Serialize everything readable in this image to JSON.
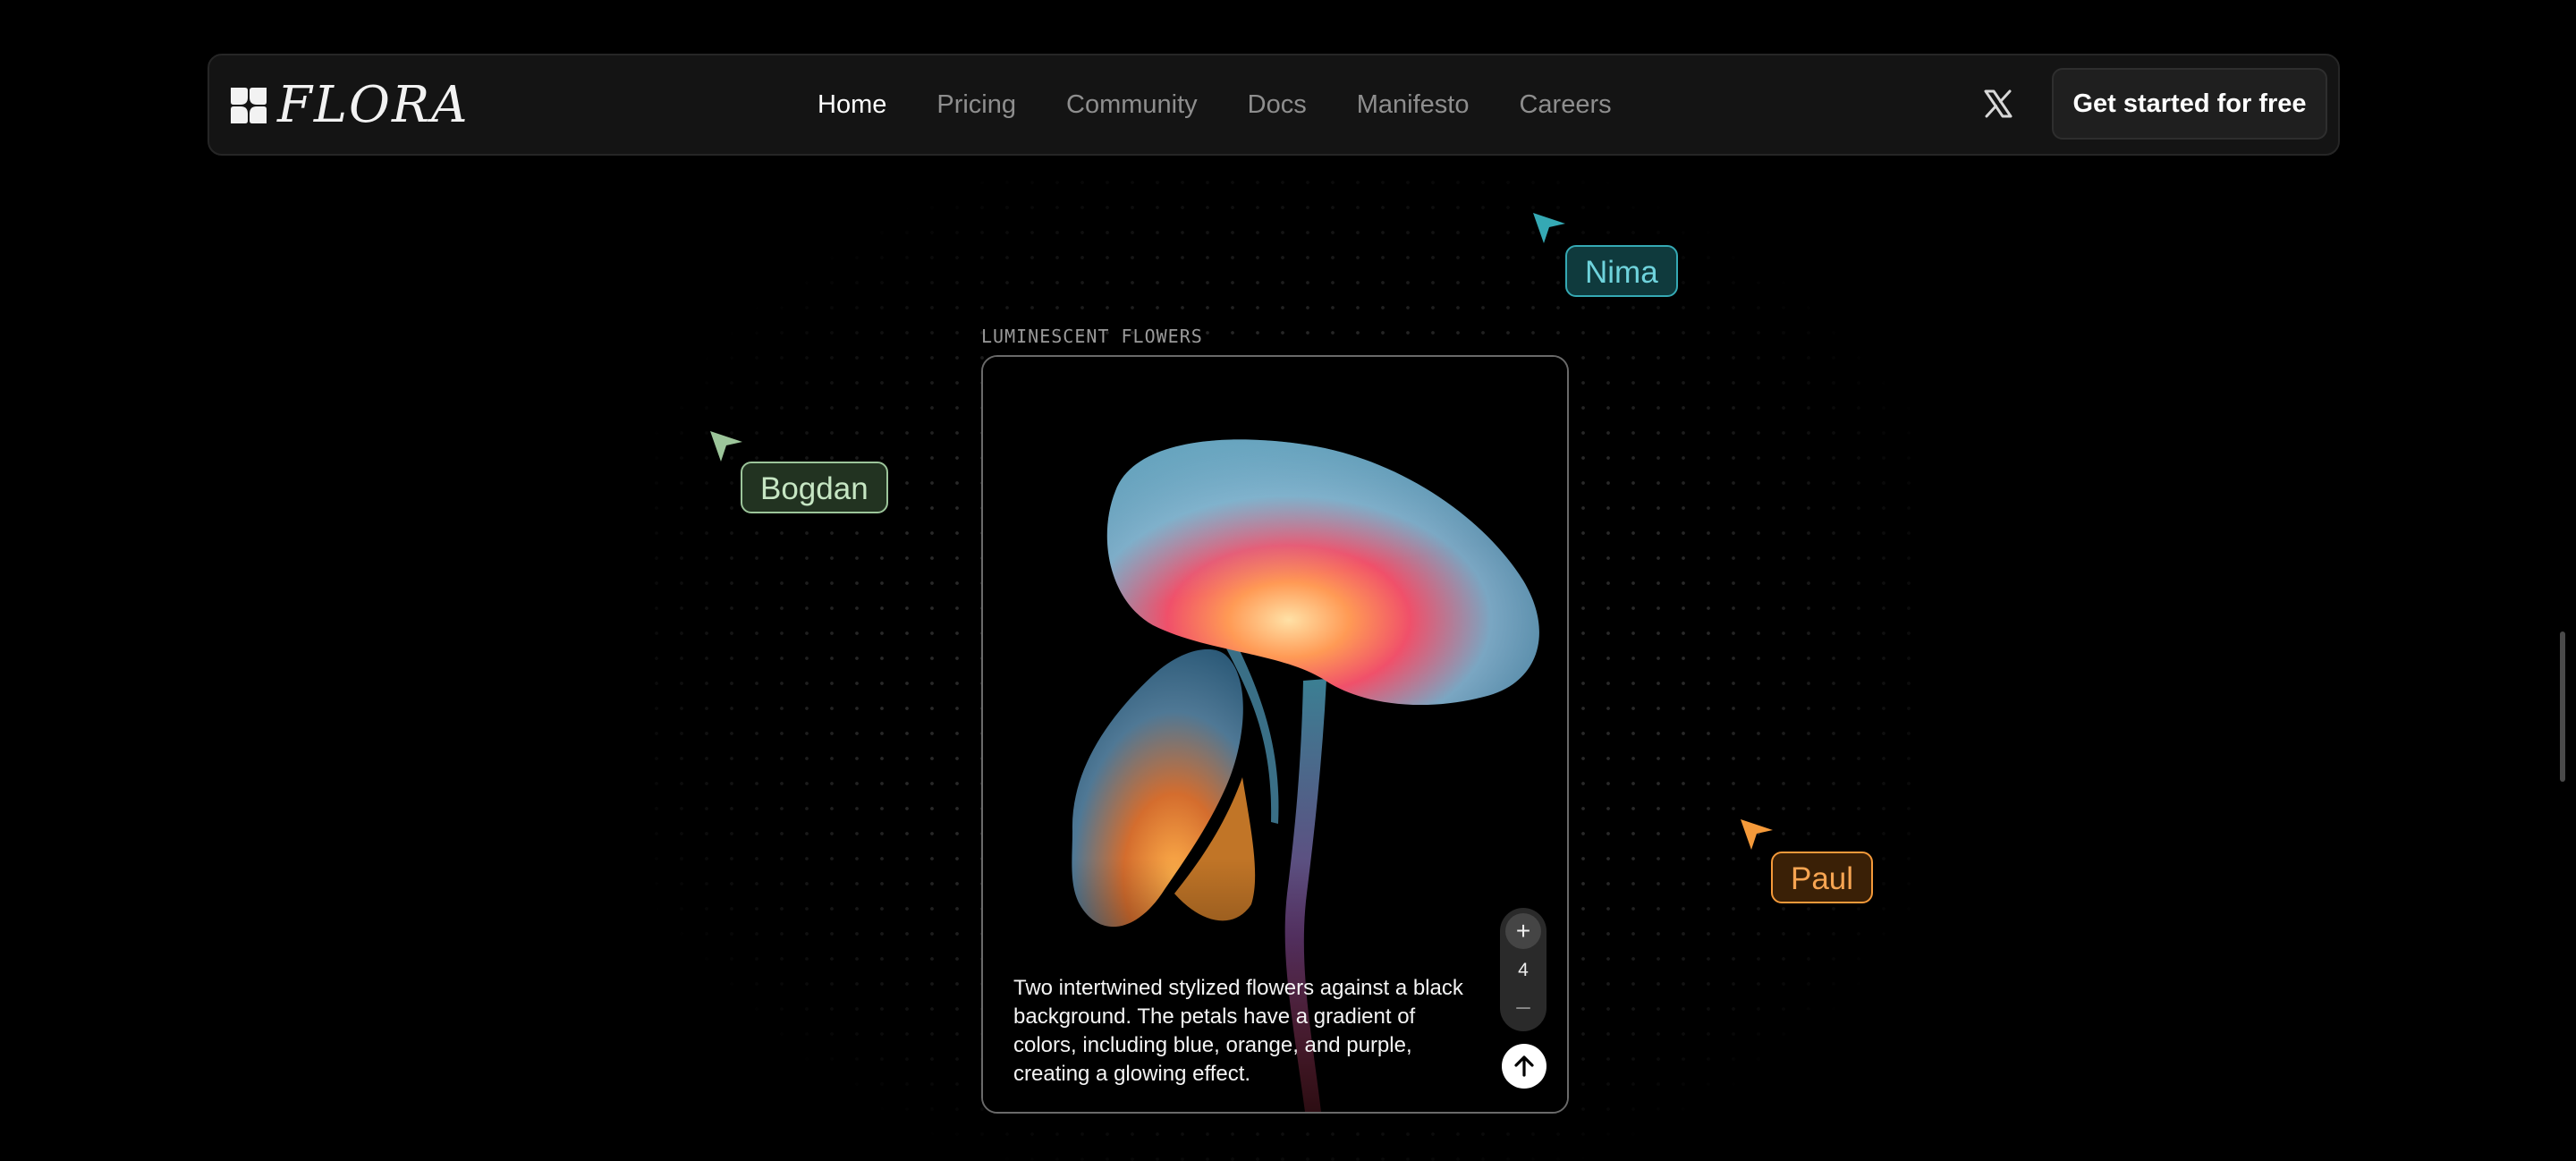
{
  "nav": {
    "logo_text": "FLORA",
    "links": [
      {
        "label": "Home",
        "active": true
      },
      {
        "label": "Pricing",
        "active": false
      },
      {
        "label": "Community",
        "active": false
      },
      {
        "label": "Docs",
        "active": false
      },
      {
        "label": "Manifesto",
        "active": false
      },
      {
        "label": "Careers",
        "active": false
      }
    ],
    "social_icon": "x-icon",
    "cta_label": "Get started for free"
  },
  "cursors": [
    {
      "name": "Nima",
      "color": "#35a9b4"
    },
    {
      "name": "Bogdan",
      "color": "#9cc59a"
    },
    {
      "name": "Paul",
      "color": "#f59a3a"
    }
  ],
  "card": {
    "caption": "LUMINESCENT FLOWERS",
    "prompt": "Two intertwined stylized flowers against a black background. The petals have a gradient of colors, including blue, orange, and purple, creating a glowing effect.",
    "count": "4",
    "plus_symbol": "+",
    "minus_symbol": "–"
  }
}
